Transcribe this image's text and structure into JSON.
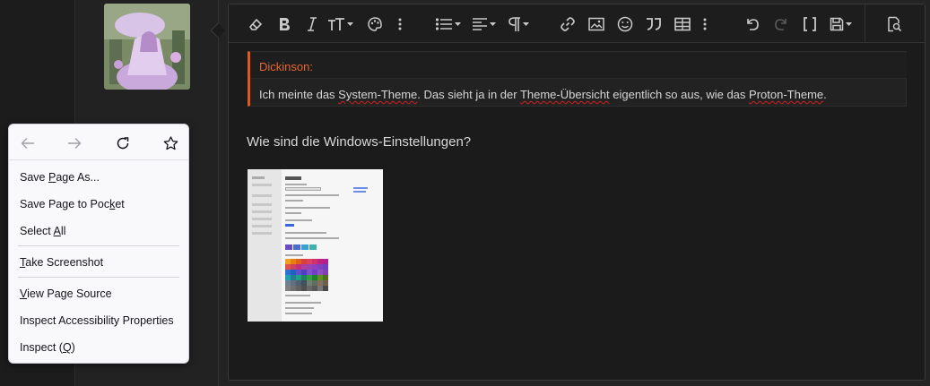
{
  "context_menu": {
    "nav": {
      "back_icon": "arrow-left-icon",
      "forward_icon": "arrow-right-icon",
      "reload_icon": "reload-icon",
      "bookmark_icon": "star-icon"
    },
    "items": [
      {
        "pre": "Save ",
        "key": "P",
        "post": "age As..."
      },
      {
        "pre": "Save Page to Poc",
        "key": "k",
        "post": "et"
      },
      {
        "pre": "Select ",
        "key": "A",
        "post": "ll"
      },
      {
        "pre": "",
        "key": "T",
        "post": "ake Screenshot"
      },
      {
        "pre": "",
        "key": "V",
        "post": "iew Page Source"
      },
      {
        "pre": "Inspect Accessibility Properties",
        "key": "",
        "post": ""
      },
      {
        "pre": "Inspect (",
        "key": "Q",
        "post": ")"
      }
    ]
  },
  "editor": {
    "toolbar_icons": [
      "eraser-icon",
      "bold-icon",
      "italic-icon",
      "text-size-icon",
      "palette-icon",
      "more-icon",
      "list-icon",
      "align-icon",
      "paragraph-icon",
      "more-icon",
      "link-icon",
      "image-icon",
      "smile-icon",
      "quote-icon",
      "table-icon",
      "more-icon",
      "undo-icon",
      "redo-icon",
      "brackets-icon",
      "save-draft-icon",
      "preview-icon"
    ],
    "quote": {
      "author": "Dickinson:",
      "text_parts": [
        "Ich meinte das ",
        "System-Theme",
        ". Das sieht ja in der ",
        "Theme-Übersicht",
        " eigentlich so aus, wie das ",
        "Proton-Theme",
        "."
      ]
    },
    "body_text": "Wie sind die Windows-Einstellungen?",
    "image_alt": "windows-settings-screenshot"
  },
  "colors": {
    "accent_orange": "#e05a20",
    "bg_dark": "#1b1b1b",
    "menu_bg": "#f9f9fb"
  }
}
